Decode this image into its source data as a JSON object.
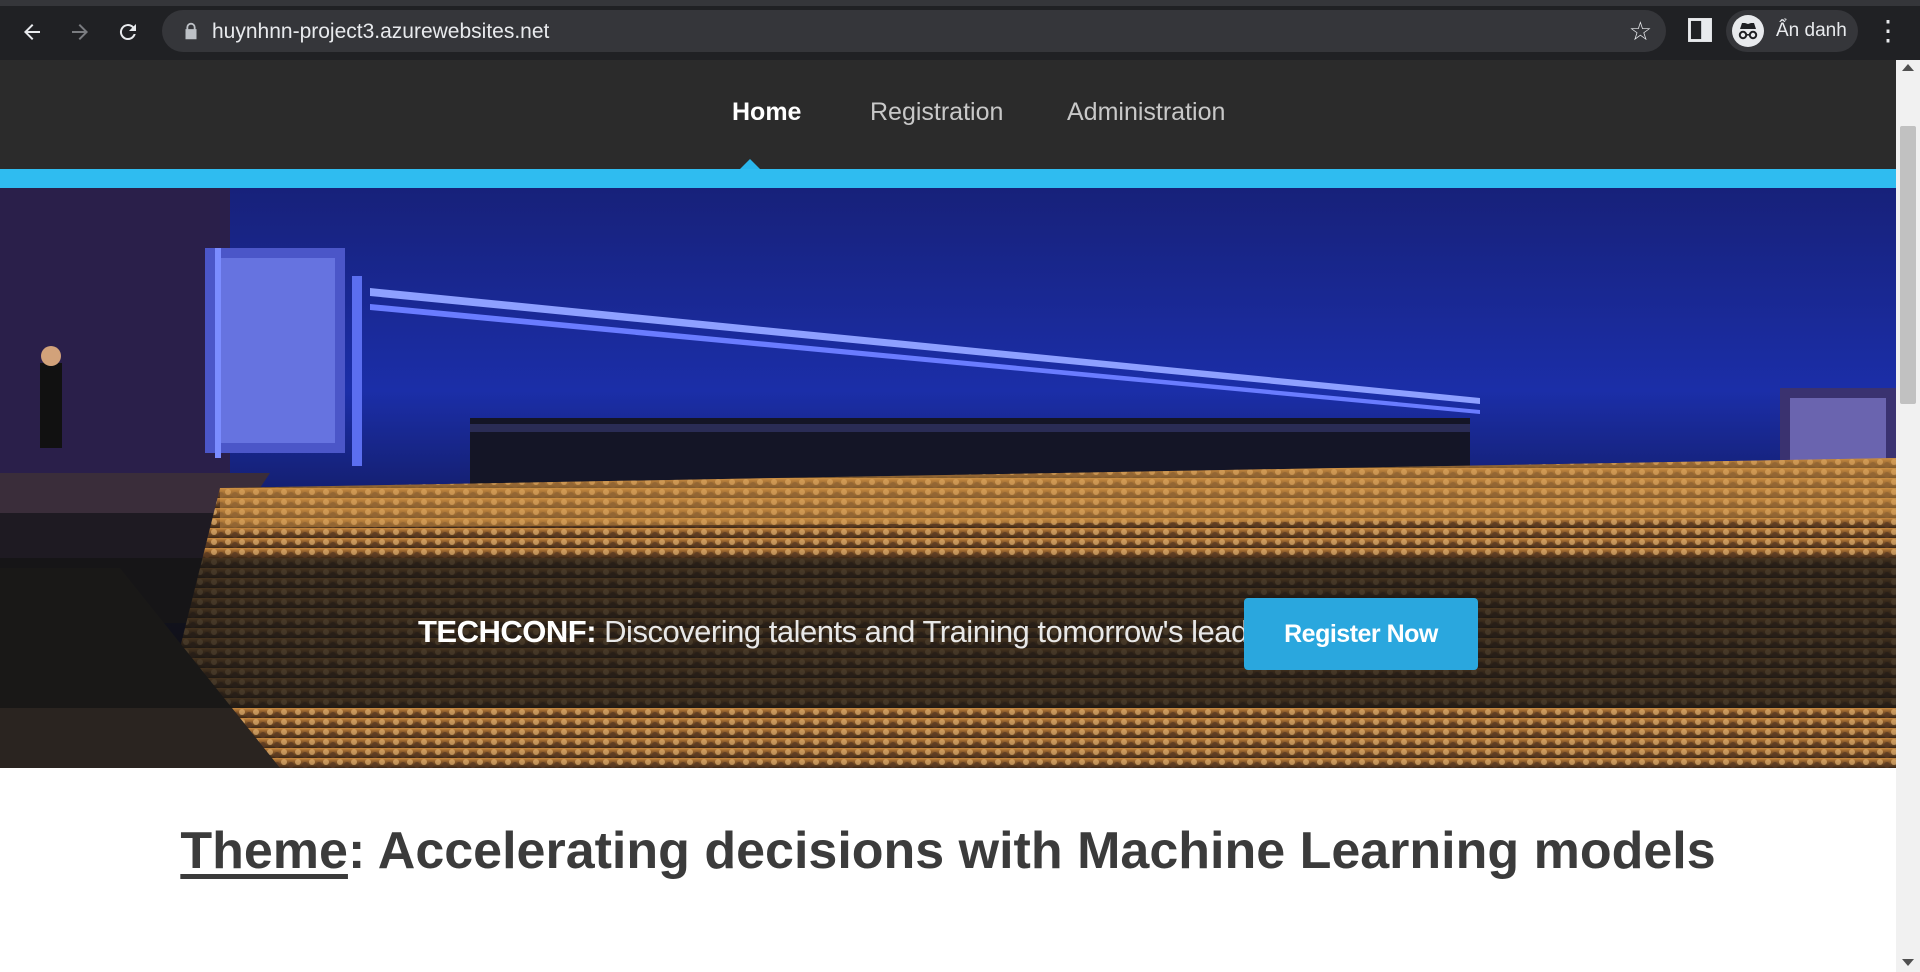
{
  "browser": {
    "url": "huynhnn-project3.azurewebsites.net",
    "profile_name": "Ẩn danh"
  },
  "nav": {
    "items": [
      {
        "label": "Home",
        "active": true
      },
      {
        "label": "Registration",
        "active": false
      },
      {
        "label": "Administration",
        "active": false
      }
    ]
  },
  "hero": {
    "brand": "TECHCONF:",
    "tagline": "Discovering talents and Training tomorrow's leaders",
    "cta_label": "Register Now"
  },
  "theme": {
    "label": "Theme",
    "text": ": Accelerating decisions with Machine Learning models"
  },
  "colors": {
    "accent": "#2fbcf0",
    "button": "#2aa7de",
    "nav_bg": "#2b2b2b",
    "browser_bg": "#202124"
  },
  "icons": [
    "back-icon",
    "forward-icon",
    "reload-icon",
    "lock-icon",
    "star-icon",
    "side-panel-icon",
    "incognito-icon",
    "menu-icon"
  ]
}
